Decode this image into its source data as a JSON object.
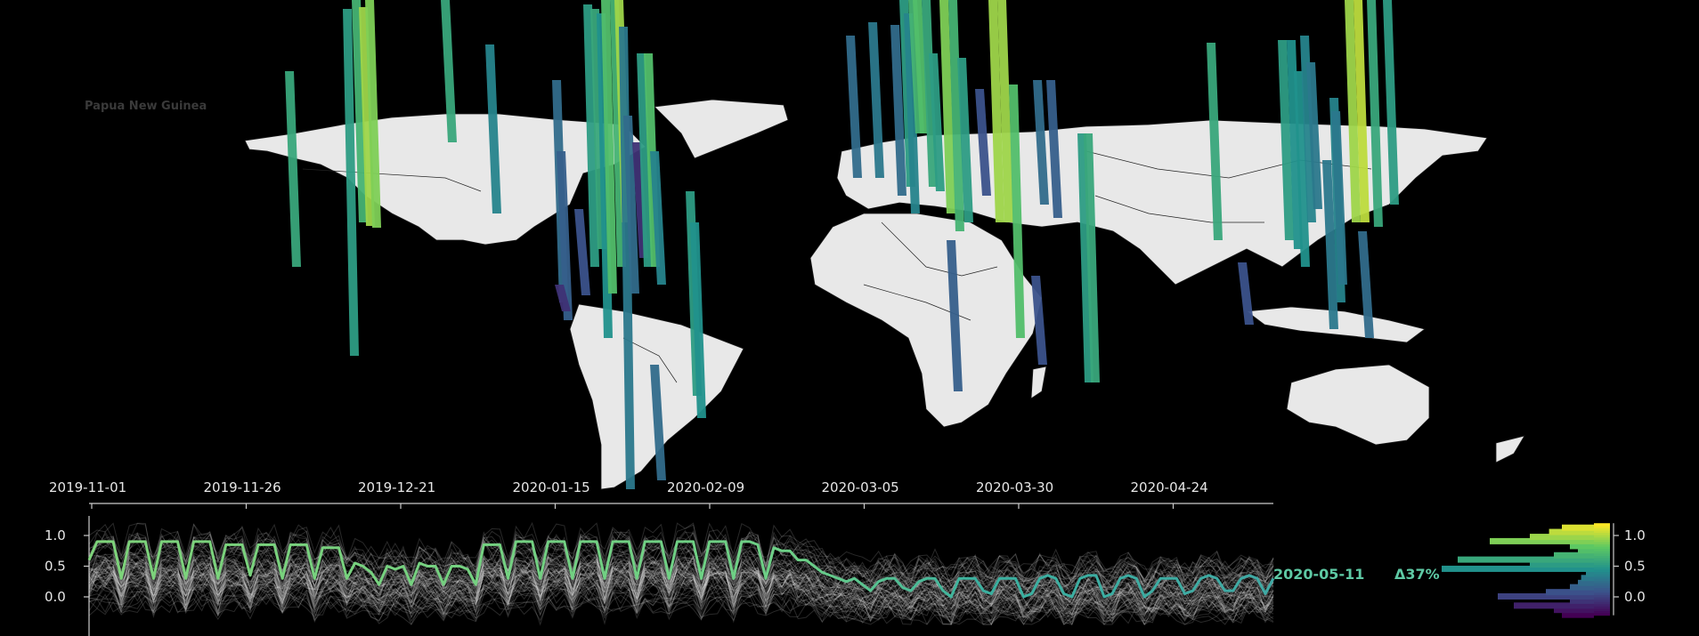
{
  "map": {
    "hover_label": "Papua New Guinea"
  },
  "readout": {
    "date": "2020-05-11",
    "change": "Δ37%"
  },
  "chart_data": [
    {
      "type": "line",
      "title": "",
      "xlabel": "",
      "ylabel": "",
      "x_ticks": [
        "2019-11-01",
        "2019-11-26",
        "2019-12-21",
        "2020-01-15",
        "2020-02-09",
        "2020-03-05",
        "2020-03-30",
        "2020-04-24"
      ],
      "x_range": [
        "2019-11-01",
        "2020-05-11"
      ],
      "y_ticks": [
        0.0,
        0.5,
        1.0
      ],
      "ylim": [
        -0.3,
        1.2
      ],
      "grid": false,
      "series": [
        {
          "name": "",
          "color_note": "viridis-coloured mean line",
          "values": [
            0.6,
            0.9,
            0.9,
            0.9,
            0.3,
            0.9,
            0.9,
            0.9,
            0.3,
            0.9,
            0.9,
            0.9,
            0.3,
            0.9,
            0.9,
            0.9,
            0.3,
            0.85,
            0.85,
            0.85,
            0.35,
            0.85,
            0.85,
            0.85,
            0.3,
            0.85,
            0.85,
            0.85,
            0.3,
            0.8,
            0.8,
            0.8,
            0.3,
            0.55,
            0.5,
            0.4,
            0.2,
            0.5,
            0.45,
            0.5,
            0.2,
            0.55,
            0.5,
            0.5,
            0.2,
            0.5,
            0.5,
            0.45,
            0.2,
            0.85,
            0.85,
            0.85,
            0.3,
            0.9,
            0.9,
            0.9,
            0.3,
            0.9,
            0.9,
            0.9,
            0.3,
            0.9,
            0.9,
            0.9,
            0.3,
            0.9,
            0.9,
            0.9,
            0.3,
            0.9,
            0.9,
            0.9,
            0.3,
            0.9,
            0.9,
            0.9,
            0.3,
            0.9,
            0.9,
            0.9,
            0.3,
            0.9,
            0.9,
            0.85,
            0.3,
            0.8,
            0.75,
            0.75,
            0.6,
            0.6,
            0.5,
            0.4,
            0.35,
            0.3,
            0.25,
            0.3,
            0.2,
            0.1,
            0.25,
            0.3,
            0.3,
            0.15,
            0.1,
            0.25,
            0.3,
            0.3,
            0.1,
            0.0,
            0.3,
            0.3,
            0.3,
            0.1,
            0.05,
            0.3,
            0.3,
            0.3,
            0.0,
            0.05,
            0.3,
            0.35,
            0.3,
            0.05,
            0.0,
            0.3,
            0.35,
            0.35,
            0.0,
            0.05,
            0.3,
            0.35,
            0.3,
            0.0,
            0.1,
            0.3,
            0.3,
            0.3,
            0.05,
            0.1,
            0.3,
            0.35,
            0.3,
            0.1,
            0.1,
            0.3,
            0.35,
            0.3,
            0.05,
            0.3
          ]
        }
      ]
    },
    {
      "type": "bar",
      "orientation": "horizontal",
      "title": "",
      "y_ticks": [
        0.0,
        0.5,
        1.0
      ],
      "colorbar": "viridis",
      "bins": [
        -0.3,
        -0.22,
        -0.15,
        -0.07,
        0.0,
        0.07,
        0.15,
        0.22,
        0.3,
        0.37,
        0.45,
        0.52,
        0.6,
        0.67,
        0.75,
        0.82,
        0.9,
        0.97,
        1.05,
        1.12
      ],
      "values": [
        0.2,
        0.25,
        0.5,
        0.15,
        0.6,
        0.3,
        0.15,
        0.1,
        0.08,
        0.05,
        0.95,
        0.4,
        0.85,
        0.25,
        0.1,
        0.15,
        0.65,
        0.4,
        0.28,
        0.2
      ]
    }
  ]
}
